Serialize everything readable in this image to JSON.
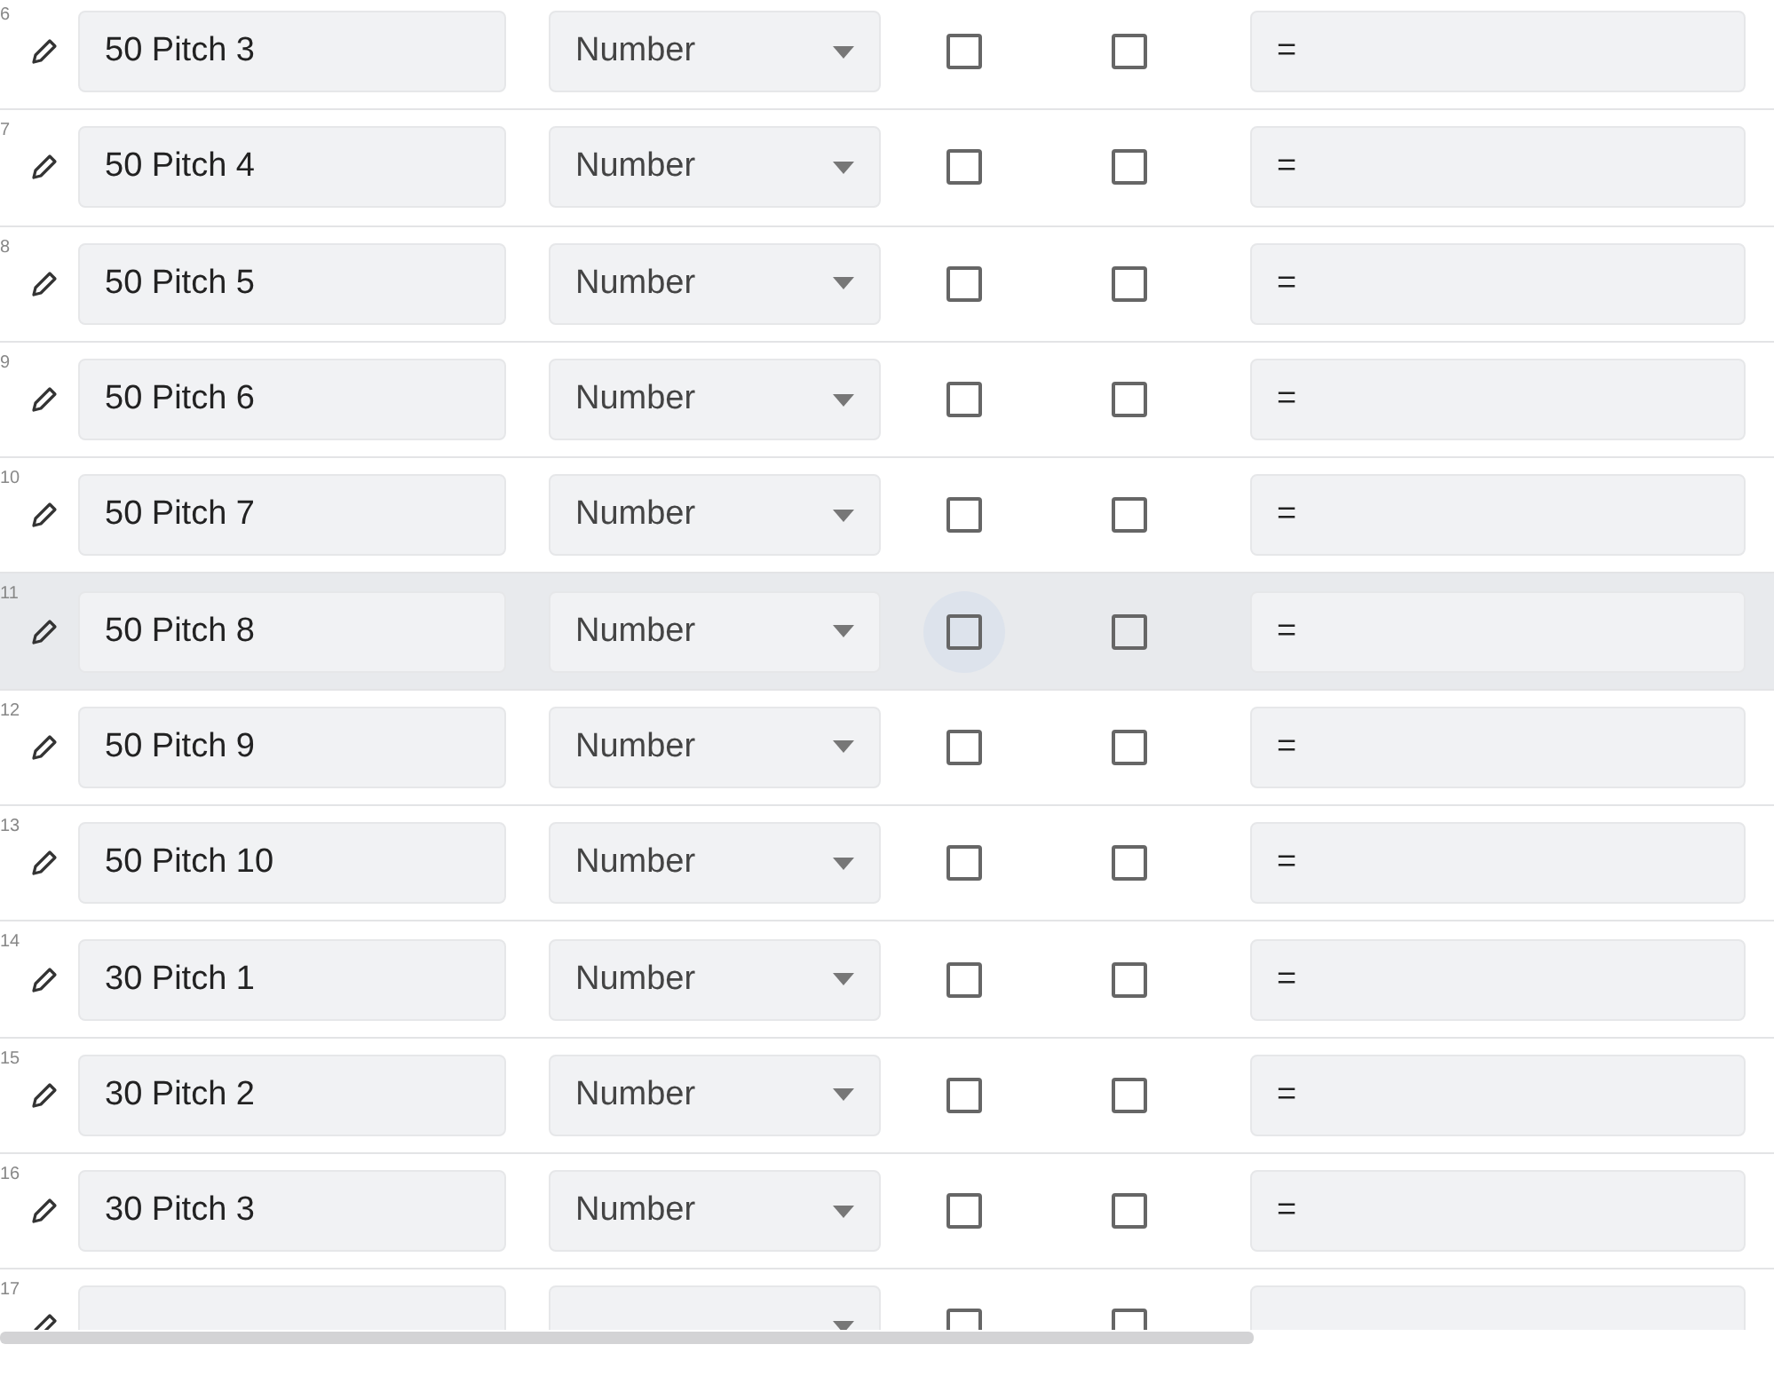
{
  "rows": [
    {
      "number": "6",
      "name": "50 Pitch 3",
      "type": "Number",
      "check_1": false,
      "check_2": false,
      "formula": "=",
      "selected": false
    },
    {
      "number": "7",
      "name": "50 Pitch 4",
      "type": "Number",
      "check_1": false,
      "check_2": false,
      "formula": "=",
      "selected": false
    },
    {
      "number": "8",
      "name": "50 Pitch 5",
      "type": "Number",
      "check_1": false,
      "check_2": false,
      "formula": "=",
      "selected": false
    },
    {
      "number": "9",
      "name": "50 Pitch 6",
      "type": "Number",
      "check_1": false,
      "check_2": false,
      "formula": "=",
      "selected": false
    },
    {
      "number": "10",
      "name": "50 Pitch 7",
      "type": "Number",
      "check_1": false,
      "check_2": false,
      "formula": "=",
      "selected": false
    },
    {
      "number": "11",
      "name": "50 Pitch 8",
      "type": "Number",
      "check_1": false,
      "check_2": false,
      "formula": "=",
      "selected": true
    },
    {
      "number": "12",
      "name": "50 Pitch 9",
      "type": "Number",
      "check_1": false,
      "check_2": false,
      "formula": "=",
      "selected": false
    },
    {
      "number": "13",
      "name": "50 Pitch 10",
      "type": "Number",
      "check_1": false,
      "check_2": false,
      "formula": "=",
      "selected": false
    },
    {
      "number": "14",
      "name": "30 Pitch 1",
      "type": "Number",
      "check_1": false,
      "check_2": false,
      "formula": "=",
      "selected": false
    },
    {
      "number": "15",
      "name": "30 Pitch 2",
      "type": "Number",
      "check_1": false,
      "check_2": false,
      "formula": "=",
      "selected": false
    },
    {
      "number": "16",
      "name": "30 Pitch 3",
      "type": "Number",
      "check_1": false,
      "check_2": false,
      "formula": "=",
      "selected": false
    },
    {
      "number": "17",
      "check_1": false,
      "check_2": false,
      "selected": false
    }
  ]
}
